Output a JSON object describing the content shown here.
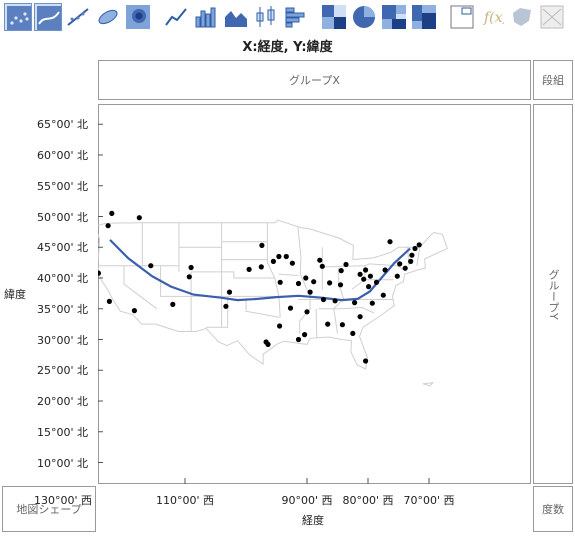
{
  "toolbar": {
    "icons": [
      "points-icon",
      "smoother-icon",
      "line-of-fit-icon",
      "ellipse-icon",
      "contour-icon",
      "line-icon",
      "bar-icon",
      "area-icon",
      "box-plot-icon",
      "histogram-icon",
      "heatmap-icon",
      "pie-icon",
      "treemap-icon",
      "mosaic-icon",
      "caption-box-icon",
      "formula-icon",
      "map-shape-icon",
      "parallel-icon"
    ]
  },
  "graph": {
    "title": "X:経度, Y:緯度",
    "group_x": "グループX",
    "group_y": "グループY",
    "wrap": "段組",
    "freq": "度数",
    "map_shape": "地図シェープ",
    "x_title": "経度",
    "y_title": "緯度"
  },
  "chart_data": {
    "type": "scatter",
    "title": "X:経度, Y:緯度",
    "xlabel": "経度",
    "ylabel": "緯度",
    "xlim": [
      -130,
      -65
    ],
    "ylim": [
      7,
      69
    ],
    "x_ticks": [
      -130,
      -110,
      -90,
      -80,
      -70
    ],
    "x_tick_labels": [
      "130°00' 西",
      "110°00' 西",
      "90°00' 西",
      "80°00' 西",
      "70°00' 西"
    ],
    "y_ticks": [
      10,
      15,
      20,
      25,
      30,
      35,
      40,
      45,
      50,
      55,
      60,
      65
    ],
    "y_tick_labels": [
      "10°00' 北",
      "15°00' 北",
      "20°00' 北",
      "25°00' 北",
      "30°00' 北",
      "35°00' 北",
      "40°00' 北",
      "45°00' 北",
      "50°00' 北",
      "55°00' 北",
      "60°00' 北",
      "65°00' 北"
    ],
    "points": [
      {
        "x": -122.0,
        "y": 50.5
      },
      {
        "x": -122.6,
        "y": 48.5
      },
      {
        "x": -117.5,
        "y": 49.8
      },
      {
        "x": -124.2,
        "y": 40.8
      },
      {
        "x": -122.4,
        "y": 36.2
      },
      {
        "x": -118.3,
        "y": 34.7
      },
      {
        "x": -112.0,
        "y": 35.7
      },
      {
        "x": -115.6,
        "y": 42.0
      },
      {
        "x": -109.0,
        "y": 41.7
      },
      {
        "x": -109.3,
        "y": 40.2
      },
      {
        "x": -102.7,
        "y": 37.7
      },
      {
        "x": -103.3,
        "y": 35.4
      },
      {
        "x": -99.5,
        "y": 41.4
      },
      {
        "x": -97.4,
        "y": 45.3
      },
      {
        "x": -97.5,
        "y": 41.8
      },
      {
        "x": -95.5,
        "y": 42.7
      },
      {
        "x": -94.6,
        "y": 43.5
      },
      {
        "x": -93.4,
        "y": 43.5
      },
      {
        "x": -92.4,
        "y": 42.4
      },
      {
        "x": -94.4,
        "y": 39.3
      },
      {
        "x": -91.4,
        "y": 39.1
      },
      {
        "x": -90.2,
        "y": 40.0
      },
      {
        "x": -87.9,
        "y": 42.9
      },
      {
        "x": -88.9,
        "y": 39.4
      },
      {
        "x": -87.5,
        "y": 41.9
      },
      {
        "x": -86.3,
        "y": 39.2
      },
      {
        "x": -84.4,
        "y": 41.2
      },
      {
        "x": -83.6,
        "y": 42.2
      },
      {
        "x": -84.5,
        "y": 38.9
      },
      {
        "x": -85.4,
        "y": 36.3
      },
      {
        "x": -87.3,
        "y": 36.5
      },
      {
        "x": -89.5,
        "y": 37.7
      },
      {
        "x": -90.0,
        "y": 34.5
      },
      {
        "x": -92.7,
        "y": 35.1
      },
      {
        "x": -94.5,
        "y": 32.2
      },
      {
        "x": -96.7,
        "y": 29.6
      },
      {
        "x": -96.4,
        "y": 29.2
      },
      {
        "x": -91.4,
        "y": 30.0
      },
      {
        "x": -90.4,
        "y": 30.8
      },
      {
        "x": -86.6,
        "y": 32.5
      },
      {
        "x": -84.2,
        "y": 32.4
      },
      {
        "x": -82.5,
        "y": 31.0
      },
      {
        "x": -80.4,
        "y": 26.5
      },
      {
        "x": -81.3,
        "y": 33.7
      },
      {
        "x": -82.2,
        "y": 36.0
      },
      {
        "x": -79.3,
        "y": 35.9
      },
      {
        "x": -77.5,
        "y": 37.2
      },
      {
        "x": -79.9,
        "y": 38.6
      },
      {
        "x": -79.6,
        "y": 40.3
      },
      {
        "x": -78.6,
        "y": 39.3
      },
      {
        "x": -77.2,
        "y": 41.3
      },
      {
        "x": -75.2,
        "y": 40.3
      },
      {
        "x": -74.8,
        "y": 42.3
      },
      {
        "x": -73.9,
        "y": 41.6
      },
      {
        "x": -73.0,
        "y": 42.7
      },
      {
        "x": -72.8,
        "y": 43.7
      },
      {
        "x": -72.3,
        "y": 44.8
      },
      {
        "x": -71.6,
        "y": 45.4
      },
      {
        "x": -76.4,
        "y": 45.9
      },
      {
        "x": -80.4,
        "y": 41.3
      },
      {
        "x": -81.3,
        "y": 40.6
      },
      {
        "x": -80.7,
        "y": 39.8
      }
    ],
    "smoother": [
      {
        "x": -122.3,
        "y": 46.2
      },
      {
        "x": -119.3,
        "y": 43.2
      },
      {
        "x": -115.4,
        "y": 40.3
      },
      {
        "x": -112.3,
        "y": 38.6
      },
      {
        "x": -108.6,
        "y": 37.3
      },
      {
        "x": -104.1,
        "y": 36.8
      },
      {
        "x": -101.4,
        "y": 36.4
      },
      {
        "x": -98.1,
        "y": 36.6
      },
      {
        "x": -95.0,
        "y": 36.9
      },
      {
        "x": -91.4,
        "y": 37.1
      },
      {
        "x": -87.6,
        "y": 36.8
      },
      {
        "x": -84.3,
        "y": 36.4
      },
      {
        "x": -81.7,
        "y": 36.6
      },
      {
        "x": -79.7,
        "y": 37.8
      },
      {
        "x": -77.8,
        "y": 40.0
      },
      {
        "x": -75.7,
        "y": 42.4
      },
      {
        "x": -73.1,
        "y": 44.8
      }
    ],
    "grid": false,
    "legend": "none"
  }
}
